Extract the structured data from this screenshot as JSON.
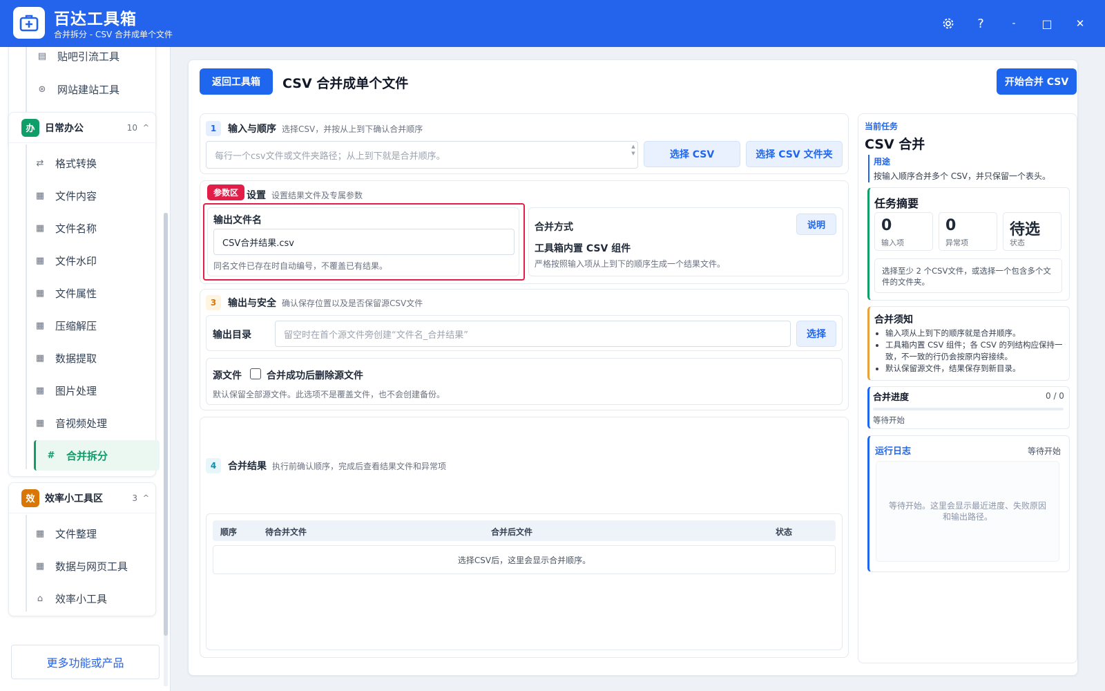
{
  "app": {
    "title": "百达工具箱",
    "subtitle": "合并拆分 - CSV 合并成单个文件"
  },
  "window_controls": {
    "settings": "gear-icon",
    "help": "?",
    "minimize": "-",
    "maximize": "□",
    "close": "✕"
  },
  "sidebar": {
    "top_items": [
      {
        "label": "贴吧引流工具",
        "icon": "doc-icon"
      },
      {
        "label": "网站建站工具",
        "icon": "globe-icon"
      }
    ],
    "group_office": {
      "badge": "办",
      "name": "日常办公",
      "count": "10",
      "caret": "^",
      "items": [
        {
          "label": "格式转换",
          "icon": "⇄"
        },
        {
          "label": "文件内容",
          "icon": "▦"
        },
        {
          "label": "文件名称",
          "icon": "▦"
        },
        {
          "label": "文件水印",
          "icon": "▦"
        },
        {
          "label": "文件属性",
          "icon": "▦"
        },
        {
          "label": "压缩解压",
          "icon": "▦"
        },
        {
          "label": "数据提取",
          "icon": "▦"
        },
        {
          "label": "图片处理",
          "icon": "▦"
        },
        {
          "label": "音视频处理",
          "icon": "▦"
        },
        {
          "label": "合并拆分",
          "icon": "#"
        }
      ]
    },
    "group_eff": {
      "badge": "效",
      "name": "效率小工具区",
      "count": "3",
      "caret": "^",
      "items": [
        {
          "label": "文件整理",
          "icon": "▦"
        },
        {
          "label": "数据与网页工具",
          "icon": "▦"
        },
        {
          "label": "效率小工具",
          "icon": "⌂"
        }
      ]
    },
    "more_label": "更多功能或产品"
  },
  "header": {
    "back_label": "返回工具箱",
    "title": "CSV 合并成单个文件",
    "start_label": "开始合并 CSV"
  },
  "section1": {
    "num": "1",
    "title": "输入与顺序",
    "desc": "选择CSV，并按从上到下确认合并顺序",
    "placeholder": "每行一个csv文件或文件夹路径；从上到下就是合并顺序。",
    "btn_csv": "选择 CSV",
    "btn_folder": "选择 CSV 文件夹"
  },
  "section2": {
    "tag": "参数区",
    "title": "设置",
    "desc": "设置结果文件及专属参数",
    "out_name_label": "输出文件名",
    "out_name_value": "CSV合并结果.csv",
    "out_name_hint": "同名文件已存在时自动编号，不覆盖已有结果。",
    "merge_mode_label": "合并方式",
    "explain_btn": "说明",
    "merge_mode_value": "工具箱内置 CSV 组件",
    "merge_mode_hint": "严格按照输入项从上到下的顺序生成一个结果文件。"
  },
  "section3": {
    "num": "3",
    "title": "输出与安全",
    "desc": "确认保存位置以及是否保留源CSV文件",
    "dir_label": "输出目录",
    "dir_placeholder": "留空时在首个源文件旁创建“文件名_合并结果”",
    "dir_btn": "选择",
    "src_label": "源文件",
    "delete_label": "合并成功后删除源文件",
    "delete_checked": false,
    "src_hint": "默认保留全部源文件。此选项不是覆盖文件，也不会创建备份。"
  },
  "section4": {
    "num": "4",
    "title": "合并结果",
    "desc": "执行前确认顺序，完成后查看结果文件和异常项",
    "columns": [
      "顺序",
      "待合并文件",
      "合并后文件",
      "状态"
    ],
    "empty": "选择CSV后，这里会显示合并顺序。"
  },
  "right": {
    "task_label": "当前任务",
    "task_title": "CSV 合并",
    "use_label": "用途",
    "use_text": "按输入顺序合并多个 CSV，并只保留一个表头。",
    "summary_title": "任务摘要",
    "stats": [
      {
        "value": "0",
        "label": "输入项"
      },
      {
        "value": "0",
        "label": "异常项"
      },
      {
        "value": "待选",
        "label": "状态"
      }
    ],
    "summary_hint": "选择至少 2 个CSV文件，或选择一个包含多个文件的文件夹。",
    "notes_title": "合并须知",
    "notes": [
      "输入项从上到下的顺序就是合并顺序。",
      "工具箱内置 CSV 组件；各 CSV 的列结构应保持一致，不一致的行仍会按原内容接续。",
      "默认保留源文件，结果保存到新目录。"
    ],
    "progress_title": "合并进度",
    "progress_count": "0 / 0",
    "progress_value": 0,
    "progress_status": "等待开始",
    "log_title": "运行日志",
    "log_status": "等待开始",
    "log_text": "等待开始。这里会显示最近进度、失败原因和输出路径。"
  },
  "colors": {
    "primary": "#1f66ee",
    "green": "#0f9d68",
    "orange": "#d97706",
    "red": "#e11d48"
  }
}
